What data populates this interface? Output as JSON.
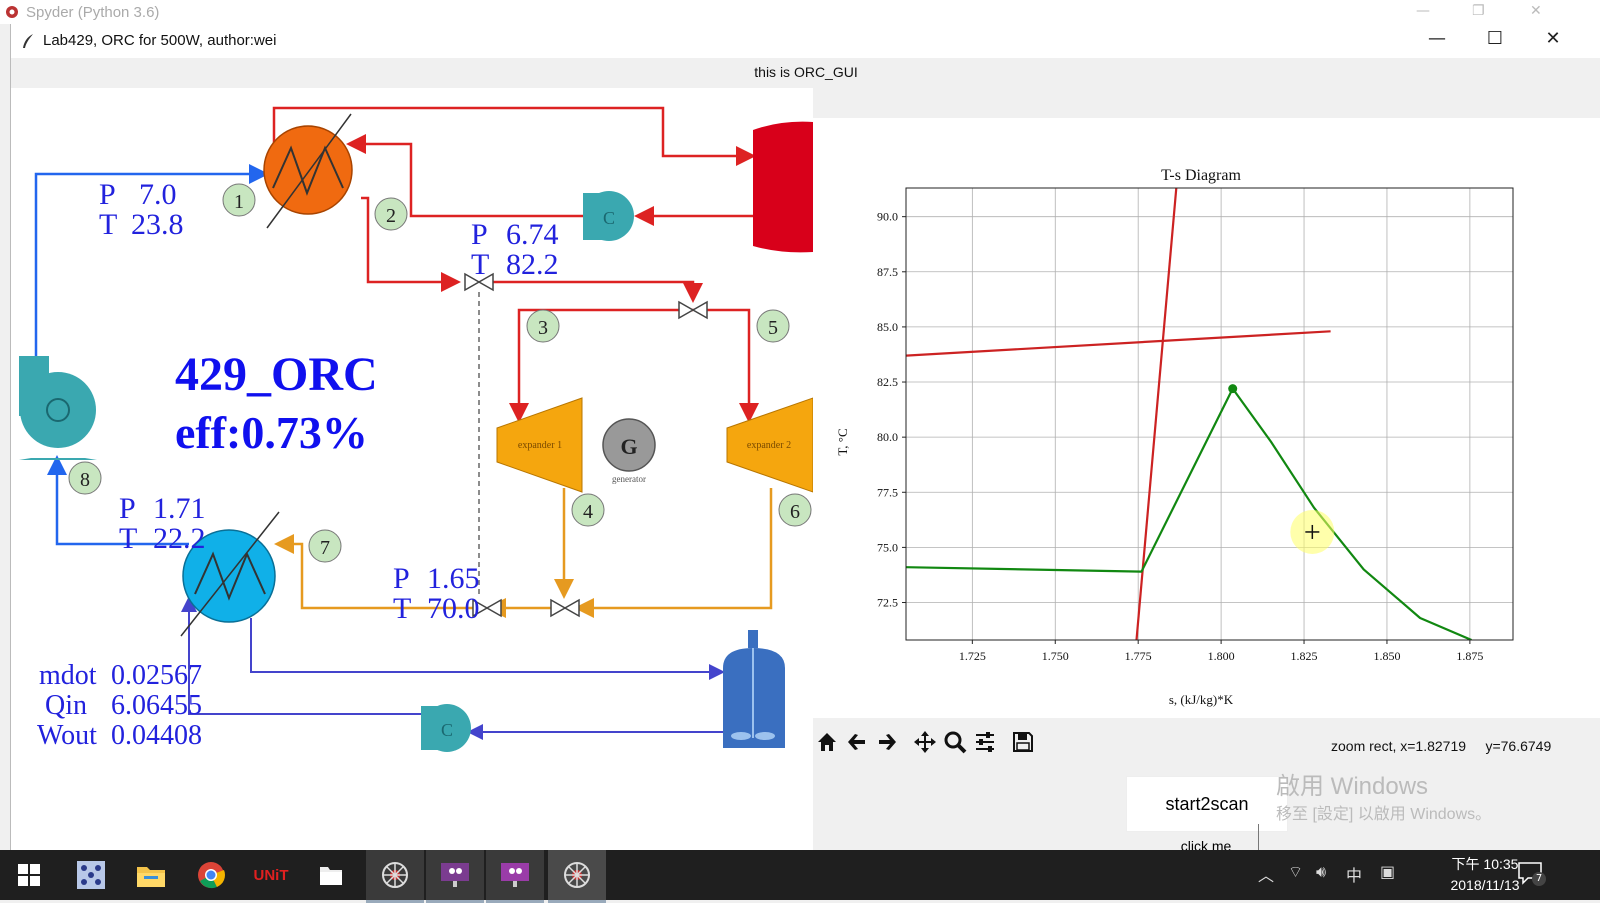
{
  "spyder": {
    "title": "Spyder (Python 3.6)"
  },
  "window": {
    "title": "Lab429, ORC for 500W, author:wei",
    "gui_label": "this is ORC_GUI"
  },
  "diagram": {
    "headline": "429_ORC",
    "efficiency": "eff:0.73%",
    "readouts": [
      {
        "p_label": "P",
        "p_value": "7.0",
        "t_label": "T",
        "t_value": "23.8"
      },
      {
        "p_label": "P",
        "p_value": "6.74",
        "t_label": "T",
        "t_value": "82.2"
      },
      {
        "p_label": "P",
        "p_value": "1.71",
        "t_label": "T",
        "t_value": "22.2"
      },
      {
        "p_label": "P",
        "p_value": "1.65",
        "t_label": "T",
        "t_value": "70.0"
      }
    ],
    "summary": [
      {
        "label": "mdot",
        "value": "0.02567"
      },
      {
        "label": "Qin",
        "value": "6.06455"
      },
      {
        "label": "Wout",
        "value": "0.04408"
      }
    ],
    "state_points": [
      "1",
      "2",
      "3",
      "4",
      "5",
      "6",
      "7",
      "8"
    ],
    "expander1": "expander 1",
    "expander2": "expander 2",
    "generator_symbol": "G",
    "generator_caption": "generator",
    "pump_symbol": "C",
    "colors": {
      "hot": "#dd2222",
      "cold": "#2266ee",
      "exhaust": "#e69a20",
      "heater": "#f06a10",
      "condenser": "#10b0e8",
      "expander": "#f5a60e",
      "pump": "#3aa8b0",
      "text_blue": "#2222dd",
      "headline": "#1010ee"
    }
  },
  "chart_data": {
    "type": "line",
    "title": "T-s Diagram",
    "xlabel": "s, (kJ/kg)*K",
    "ylabel": "T, °C",
    "xlim": [
      1.705,
      1.888
    ],
    "ylim": [
      70.8,
      91.3
    ],
    "xticks": [
      "1.725",
      "1.750",
      "1.775",
      "1.800",
      "1.825",
      "1.850",
      "1.875"
    ],
    "yticks": [
      "72.5",
      "75.0",
      "77.5",
      "80.0",
      "82.5",
      "85.0",
      "87.5",
      "90.0"
    ],
    "grid": true,
    "series": [
      {
        "color": "#cc2222",
        "points": [
          [
            1.705,
            83.7
          ],
          [
            1.833,
            84.8
          ]
        ]
      },
      {
        "color": "#cc2222",
        "points": [
          [
            1.7745,
            70.8
          ],
          [
            1.7865,
            91.3
          ]
        ]
      },
      {
        "color": "#118811",
        "points": [
          [
            1.705,
            74.1
          ],
          [
            1.776,
            73.9
          ],
          [
            1.8035,
            82.2
          ],
          [
            1.815,
            79.8
          ],
          [
            1.828,
            76.8
          ],
          [
            1.843,
            74.0
          ],
          [
            1.86,
            71.8
          ],
          [
            1.8755,
            70.8
          ]
        ]
      }
    ],
    "markers": [
      {
        "x": 1.8035,
        "y": 82.2,
        "color": "#118811"
      }
    ],
    "cursor": {
      "x": 1.8275,
      "y": 75.7
    }
  },
  "toolbar": {
    "buttons": [
      "home-icon",
      "back-arrow-icon",
      "forward-arrow-icon",
      "pan-icon",
      "zoom-icon",
      "configure-subplots-icon",
      "save-icon"
    ],
    "status": "zoom rect, x=1.82719     y=76.6749"
  },
  "actions": {
    "scan_button": "start2scan",
    "click_label": "click me"
  },
  "watermark": {
    "line1": "啟用 Windows",
    "line2": "移至 [設定] 以啟用 Windows。"
  },
  "taskbar": {
    "time": "下午 10:35",
    "date": "2018/11/13",
    "ime": "中",
    "notifications": "7",
    "unit_app": "UNiT"
  }
}
